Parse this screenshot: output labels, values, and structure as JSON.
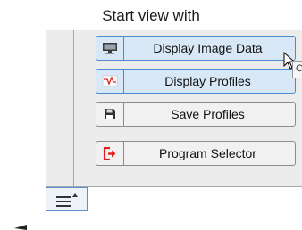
{
  "caption": "Start view with",
  "buttons": [
    {
      "label": "Display Image Data",
      "icon": "monitor-icon",
      "highlighted": true
    },
    {
      "label": "Display Profiles",
      "icon": "profile-wave-icon",
      "highlighted": true
    },
    {
      "label": "Save Profiles",
      "icon": "floppy-disk-icon",
      "highlighted": false
    },
    {
      "label": "Program Selector",
      "icon": "exit-arrow-icon",
      "highlighted": false
    }
  ],
  "tooltip_peek": "C",
  "colors": {
    "highlight_fill": "#d9e8f7",
    "highlight_border": "#4a8ad1",
    "exit_red": "#e0201e"
  }
}
